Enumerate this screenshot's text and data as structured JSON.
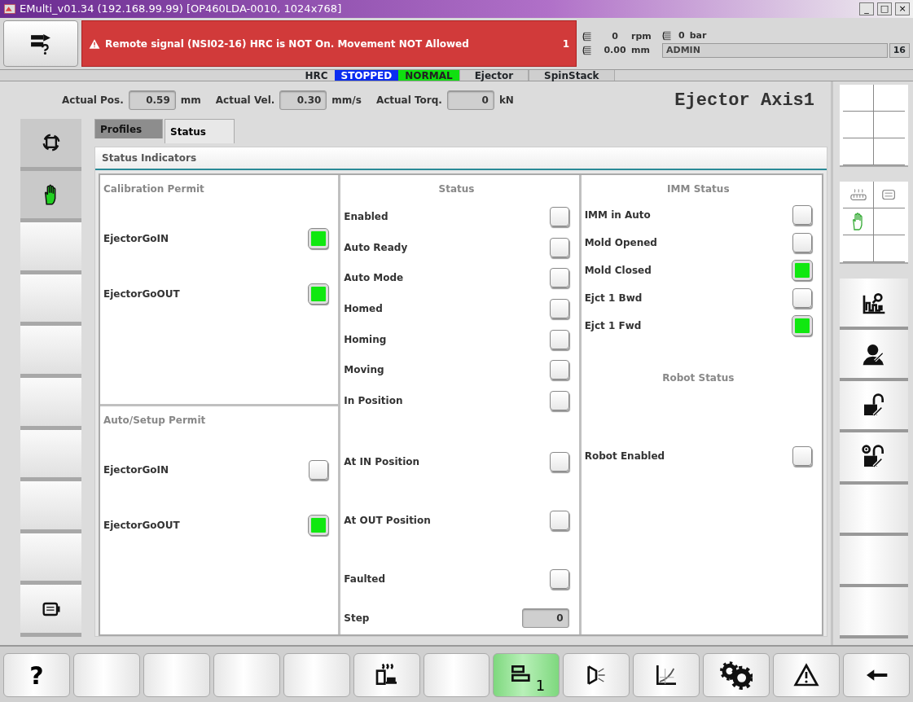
{
  "window": {
    "title": "EMulti_v01.34 (192.168.99.99) [OP460LDA-0010, 1024x768]",
    "controls": [
      "_",
      "□",
      "×"
    ]
  },
  "header": {
    "alarm": {
      "text": "Remote signal (NSI02-16) HRC is NOT On. Movement NOT Allowed",
      "count": "1"
    },
    "readouts": [
      {
        "value": "0",
        "unit": "rpm"
      },
      {
        "value": "0.00",
        "unit": "mm"
      }
    ],
    "pressure": {
      "value": "0",
      "unit": "bar"
    },
    "user": "ADMIN",
    "user_count": "16"
  },
  "status_strip": [
    {
      "text": "HRC",
      "kind": "label"
    },
    {
      "text": "STOPPED",
      "kind": "state",
      "color": "#0a2cf0"
    },
    {
      "text": "NORMAL",
      "kind": "state",
      "color": "#10e010"
    },
    {
      "text": "Ejector",
      "kind": "tab"
    },
    {
      "text": "SpinStack",
      "kind": "tab"
    }
  ],
  "readings": [
    {
      "label": "Actual Pos.",
      "value": "0.59",
      "unit": "mm"
    },
    {
      "label": "Actual Vel.",
      "value": "0.30",
      "unit": "mm/s"
    },
    {
      "label": "Actual Torq.",
      "value": "0",
      "unit": "kN"
    }
  ],
  "axis_title": "Ejector Axis1",
  "tabs": [
    {
      "label": "Profiles",
      "selected": false
    },
    {
      "label": "Status",
      "selected": true
    }
  ],
  "panel_title": "Status Indicators",
  "permits": [
    {
      "title": "Calibration Permit",
      "items": [
        {
          "label": "EjectorGoIN",
          "on": true
        },
        {
          "label": "EjectorGoOUT",
          "on": true
        }
      ]
    },
    {
      "title": "Auto/Setup Permit",
      "items": [
        {
          "label": "EjectorGoIN",
          "on": false
        },
        {
          "label": "EjectorGoOUT",
          "on": true
        }
      ]
    }
  ],
  "status": {
    "title": "Status",
    "items": [
      {
        "label": "Enabled",
        "on": false
      },
      {
        "label": "Auto Ready",
        "on": false
      },
      {
        "label": "Auto Mode",
        "on": false
      },
      {
        "label": "Homed",
        "on": false
      },
      {
        "label": "Homing",
        "on": false
      },
      {
        "label": "Moving",
        "on": false
      },
      {
        "label": "In Position",
        "on": false
      }
    ],
    "position_items": [
      {
        "label": "At IN Position",
        "on": false
      },
      {
        "label": "At OUT Position",
        "on": false
      },
      {
        "label": "Faulted",
        "on": false
      }
    ],
    "step": {
      "label": "Step",
      "value": "0"
    }
  },
  "imm_status": {
    "title": "IMM Status",
    "items": [
      {
        "label": "IMM in Auto",
        "on": false
      },
      {
        "label": "Mold Opened",
        "on": false
      },
      {
        "label": "Mold Closed",
        "on": true
      },
      {
        "label": "Ejct 1 Bwd",
        "on": false
      },
      {
        "label": "Ejct 1 Fwd",
        "on": true
      }
    ]
  },
  "robot_status": {
    "title": "Robot Status",
    "items": [
      {
        "label": "Robot Enabled",
        "on": false
      }
    ]
  },
  "left_buttons": [
    {
      "kind": "cycle"
    },
    {
      "kind": "hand"
    },
    {
      "kind": "blank"
    },
    {
      "kind": "blank"
    },
    {
      "kind": "blank"
    },
    {
      "kind": "blank"
    },
    {
      "kind": "blank"
    },
    {
      "kind": "blank"
    },
    {
      "kind": "blank"
    },
    {
      "kind": "list"
    }
  ],
  "right_buttons": [
    {
      "kind": "chart-search"
    },
    {
      "kind": "person-wrench"
    },
    {
      "kind": "lock-wrench"
    },
    {
      "kind": "lock-target"
    },
    {
      "kind": "blank"
    },
    {
      "kind": "blank"
    },
    {
      "kind": "blank"
    }
  ],
  "bottom_buttons": [
    {
      "kind": "help",
      "text": "?",
      "selected": false
    },
    {
      "kind": "blank",
      "selected": false
    },
    {
      "kind": "blank",
      "selected": false
    },
    {
      "kind": "blank",
      "selected": false
    },
    {
      "kind": "blank",
      "selected": false
    },
    {
      "kind": "heater",
      "selected": false
    },
    {
      "kind": "blank",
      "selected": false
    },
    {
      "kind": "profile",
      "text": "1",
      "selected": true
    },
    {
      "kind": "nozzle",
      "selected": false
    },
    {
      "kind": "chart",
      "selected": false
    },
    {
      "kind": "gears",
      "selected": false
    },
    {
      "kind": "warning",
      "selected": false
    },
    {
      "kind": "back",
      "selected": false
    }
  ]
}
